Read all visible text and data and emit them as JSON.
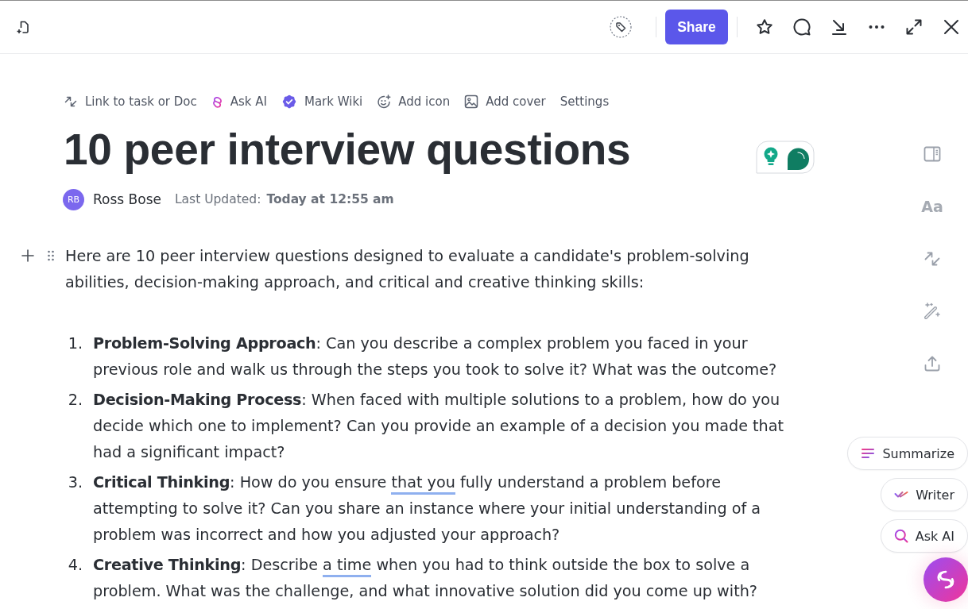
{
  "topbar": {
    "share_button": "Share"
  },
  "doc_actions": [
    {
      "label": "Link to task or Doc"
    },
    {
      "label": "Ask AI"
    },
    {
      "label": "Mark Wiki"
    },
    {
      "label": "Add icon"
    },
    {
      "label": "Add cover"
    },
    {
      "label": "Settings"
    }
  ],
  "title": "10 peer interview questions",
  "author": {
    "initials": "RB",
    "name": "Ross Bose"
  },
  "updated": {
    "label": "Last Updated:",
    "value": "Today at 12:55 am"
  },
  "intro": "Here are 10 peer interview questions designed to evaluate a candidate's problem-solving abilities, decision-making approach, and critical and creative thinking skills:",
  "questions": [
    {
      "number": "1.",
      "term": "Problem-Solving Approach",
      "parts": [
        {
          "text": ": Can you describe a complex problem you faced in your previous role and walk us through the steps you took to solve it? What was the outcome?",
          "flagged": false
        }
      ]
    },
    {
      "number": "2.",
      "term": "Decision-Making Process",
      "parts": [
        {
          "text": ": When faced with multiple solutions to a problem, how do you decide which one to implement? Can you provide an example of a decision you made that had a significant impact?",
          "flagged": false
        }
      ]
    },
    {
      "number": "3.",
      "term": "Critical Thinking",
      "parts": [
        {
          "text": ": How do you ensure ",
          "flagged": false
        },
        {
          "text": "that you",
          "flagged": true
        },
        {
          "text": " fully understand a problem before attempting to solve it? Can you share an instance where your initial understanding of a problem was incorrect and how you adjusted your approach?",
          "flagged": false
        }
      ]
    },
    {
      "number": "4.",
      "term": "Creative Thinking",
      "parts": [
        {
          "text": ": Describe ",
          "flagged": false
        },
        {
          "text": "a time",
          "flagged": true
        },
        {
          "text": " when you had to think outside the box to solve a problem. What was the challenge, and what innovative solution did you come up with?",
          "flagged": false
        }
      ]
    }
  ],
  "side_rail": {
    "text_style_label": "Aa"
  },
  "ai_actions": [
    {
      "label": "Summarize"
    },
    {
      "label": "Writer"
    },
    {
      "label": "Ask AI"
    }
  ]
}
